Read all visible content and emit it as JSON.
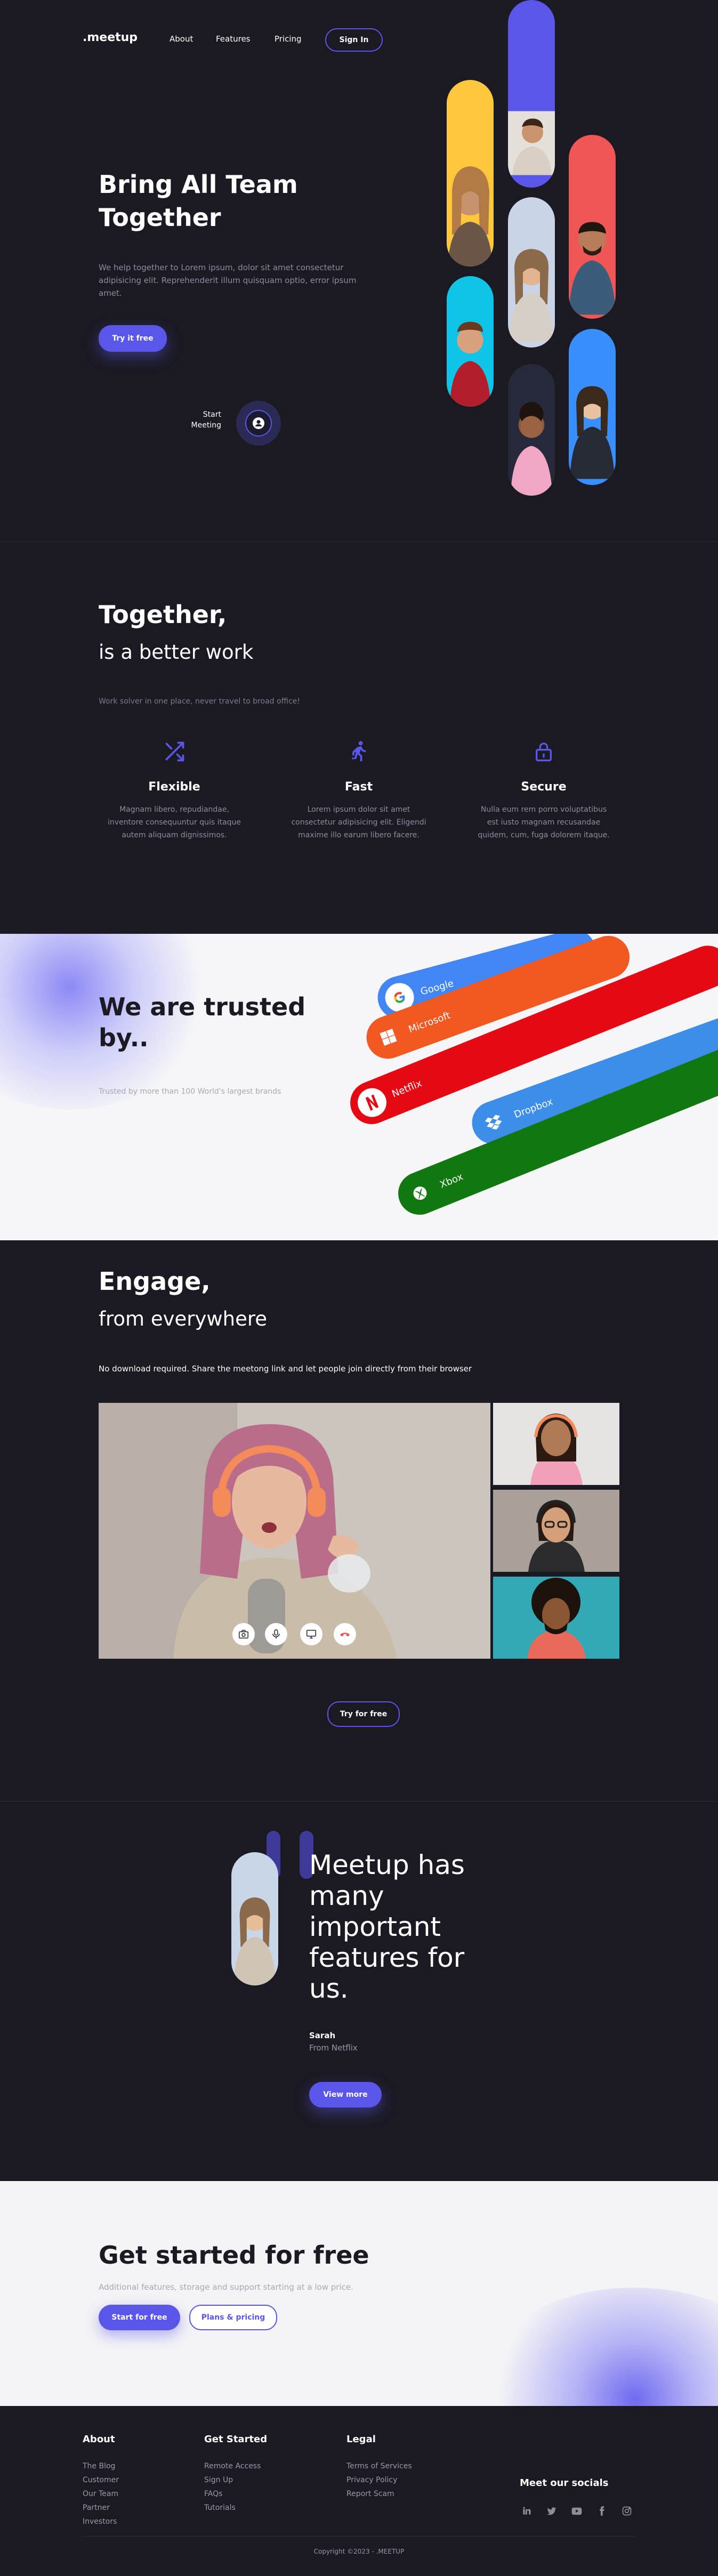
{
  "nav": {
    "logo": ".meetup",
    "links": [
      "About",
      "Features",
      "Pricing"
    ],
    "signin": "Sign In"
  },
  "hero": {
    "title": "Bring All Team Together",
    "description": "We help together to Lorem ipsum, dolor sit amet consectetur adipisicing elit. Reprehenderit illum quisquam optio, error ipsum amet.",
    "cta": "Try it free",
    "start_meeting": "Start Meeting"
  },
  "together": {
    "title": "Together,",
    "subtitle": "is a better work",
    "tagline": "Work solver in one place, never travel to broad office!",
    "features": [
      {
        "icon": "shuffle-icon",
        "title": "Flexible",
        "text": "Magnam libero, repudiandae, inventore consequuntur quis itaque autem aliquam dignissimos."
      },
      {
        "icon": "running-icon",
        "title": "Fast",
        "text": "Lorem ipsum dolor sit amet consectetur adipisicing elit. Eligendi maxime illo earum libero facere."
      },
      {
        "icon": "lock-icon",
        "title": "Secure",
        "text": "Nulla eum rem porro voluptatibus est iusto magnam recusandae quidem, cum, fuga dolorem itaque."
      }
    ],
    "accent": "#5b56ea"
  },
  "trusted": {
    "title": "We are trusted by..",
    "subtitle": "Trusted by more than 100 World's largest brands",
    "brands": [
      {
        "name": "Google",
        "color": "#4286f5",
        "icon": "google-icon"
      },
      {
        "name": "Microsoft",
        "color": "#f25822",
        "icon": "microsoft-icon"
      },
      {
        "name": "Netflix",
        "color": "#e50914",
        "icon": "netflix-icon"
      },
      {
        "name": "Dropbox",
        "color": "#3d8ee8",
        "icon": "dropbox-icon"
      },
      {
        "name": "Xbox",
        "color": "#10780f",
        "icon": "xbox-icon"
      }
    ]
  },
  "engage": {
    "title": "Engage,",
    "subtitle": "from everywhere",
    "description": "No download required. Share the meetong link and let people join directly from their browser",
    "cta": "Try for free"
  },
  "testimonial": {
    "quote": "Meetup has many important features for us.",
    "author": "Sarah",
    "source": "From Netflix",
    "cta": "View more"
  },
  "started": {
    "title": "Get started for free",
    "subtitle": "Additional features, storage and support starting at a low price.",
    "primary": "Start for free",
    "secondary": "Plans & pricing"
  },
  "footer": {
    "columns": [
      {
        "title": "About",
        "items": [
          "The Blog",
          "Customer",
          "Our Team",
          "Partner",
          "Investors"
        ]
      },
      {
        "title": "Get Started",
        "items": [
          "Remote Access",
          "Sign Up",
          "FAQs",
          "Tutorials"
        ]
      },
      {
        "title": "Legal",
        "items": [
          "Terms of Services",
          "Privacy Policy",
          "Report Scam"
        ]
      }
    ],
    "socials_title": "Meet our socials",
    "socials": [
      "linkedin-icon",
      "twitter-icon",
      "youtube-icon",
      "facebook-icon",
      "instagram-icon"
    ],
    "copyright": "Copyright ©2023 - .MEETUP"
  }
}
